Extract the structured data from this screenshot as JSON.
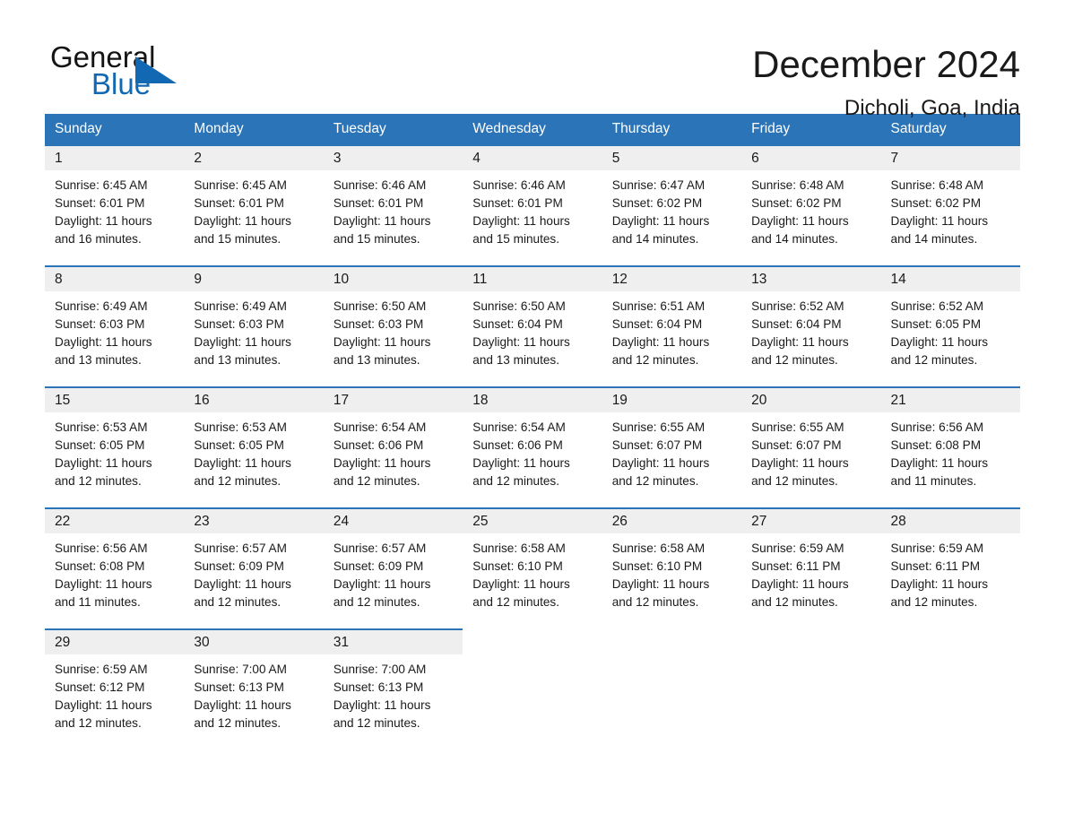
{
  "brand": {
    "name_part1": "General",
    "name_part2": "Blue",
    "triangle_icon": "brand-triangle-icon",
    "accent_color": "#1268b3"
  },
  "header": {
    "month_title": "December 2024",
    "location": "Dicholi, Goa, India"
  },
  "theme": {
    "header_blue": "#2b74b8",
    "row_border_blue": "#2b74b8",
    "daynum_band_gray": "#efefef",
    "text_color": "#1a1a1a"
  },
  "weekday_headers": [
    "Sunday",
    "Monday",
    "Tuesday",
    "Wednesday",
    "Thursday",
    "Friday",
    "Saturday"
  ],
  "weeks": [
    [
      {
        "day": "1",
        "sunrise": "Sunrise: 6:45 AM",
        "sunset": "Sunset: 6:01 PM",
        "daylight": "Daylight: 11 hours and 16 minutes."
      },
      {
        "day": "2",
        "sunrise": "Sunrise: 6:45 AM",
        "sunset": "Sunset: 6:01 PM",
        "daylight": "Daylight: 11 hours and 15 minutes."
      },
      {
        "day": "3",
        "sunrise": "Sunrise: 6:46 AM",
        "sunset": "Sunset: 6:01 PM",
        "daylight": "Daylight: 11 hours and 15 minutes."
      },
      {
        "day": "4",
        "sunrise": "Sunrise: 6:46 AM",
        "sunset": "Sunset: 6:01 PM",
        "daylight": "Daylight: 11 hours and 15 minutes."
      },
      {
        "day": "5",
        "sunrise": "Sunrise: 6:47 AM",
        "sunset": "Sunset: 6:02 PM",
        "daylight": "Daylight: 11 hours and 14 minutes."
      },
      {
        "day": "6",
        "sunrise": "Sunrise: 6:48 AM",
        "sunset": "Sunset: 6:02 PM",
        "daylight": "Daylight: 11 hours and 14 minutes."
      },
      {
        "day": "7",
        "sunrise": "Sunrise: 6:48 AM",
        "sunset": "Sunset: 6:02 PM",
        "daylight": "Daylight: 11 hours and 14 minutes."
      }
    ],
    [
      {
        "day": "8",
        "sunrise": "Sunrise: 6:49 AM",
        "sunset": "Sunset: 6:03 PM",
        "daylight": "Daylight: 11 hours and 13 minutes."
      },
      {
        "day": "9",
        "sunrise": "Sunrise: 6:49 AM",
        "sunset": "Sunset: 6:03 PM",
        "daylight": "Daylight: 11 hours and 13 minutes."
      },
      {
        "day": "10",
        "sunrise": "Sunrise: 6:50 AM",
        "sunset": "Sunset: 6:03 PM",
        "daylight": "Daylight: 11 hours and 13 minutes."
      },
      {
        "day": "11",
        "sunrise": "Sunrise: 6:50 AM",
        "sunset": "Sunset: 6:04 PM",
        "daylight": "Daylight: 11 hours and 13 minutes."
      },
      {
        "day": "12",
        "sunrise": "Sunrise: 6:51 AM",
        "sunset": "Sunset: 6:04 PM",
        "daylight": "Daylight: 11 hours and 12 minutes."
      },
      {
        "day": "13",
        "sunrise": "Sunrise: 6:52 AM",
        "sunset": "Sunset: 6:04 PM",
        "daylight": "Daylight: 11 hours and 12 minutes."
      },
      {
        "day": "14",
        "sunrise": "Sunrise: 6:52 AM",
        "sunset": "Sunset: 6:05 PM",
        "daylight": "Daylight: 11 hours and 12 minutes."
      }
    ],
    [
      {
        "day": "15",
        "sunrise": "Sunrise: 6:53 AM",
        "sunset": "Sunset: 6:05 PM",
        "daylight": "Daylight: 11 hours and 12 minutes."
      },
      {
        "day": "16",
        "sunrise": "Sunrise: 6:53 AM",
        "sunset": "Sunset: 6:05 PM",
        "daylight": "Daylight: 11 hours and 12 minutes."
      },
      {
        "day": "17",
        "sunrise": "Sunrise: 6:54 AM",
        "sunset": "Sunset: 6:06 PM",
        "daylight": "Daylight: 11 hours and 12 minutes."
      },
      {
        "day": "18",
        "sunrise": "Sunrise: 6:54 AM",
        "sunset": "Sunset: 6:06 PM",
        "daylight": "Daylight: 11 hours and 12 minutes."
      },
      {
        "day": "19",
        "sunrise": "Sunrise: 6:55 AM",
        "sunset": "Sunset: 6:07 PM",
        "daylight": "Daylight: 11 hours and 12 minutes."
      },
      {
        "day": "20",
        "sunrise": "Sunrise: 6:55 AM",
        "sunset": "Sunset: 6:07 PM",
        "daylight": "Daylight: 11 hours and 12 minutes."
      },
      {
        "day": "21",
        "sunrise": "Sunrise: 6:56 AM",
        "sunset": "Sunset: 6:08 PM",
        "daylight": "Daylight: 11 hours and 11 minutes."
      }
    ],
    [
      {
        "day": "22",
        "sunrise": "Sunrise: 6:56 AM",
        "sunset": "Sunset: 6:08 PM",
        "daylight": "Daylight: 11 hours and 11 minutes."
      },
      {
        "day": "23",
        "sunrise": "Sunrise: 6:57 AM",
        "sunset": "Sunset: 6:09 PM",
        "daylight": "Daylight: 11 hours and 12 minutes."
      },
      {
        "day": "24",
        "sunrise": "Sunrise: 6:57 AM",
        "sunset": "Sunset: 6:09 PM",
        "daylight": "Daylight: 11 hours and 12 minutes."
      },
      {
        "day": "25",
        "sunrise": "Sunrise: 6:58 AM",
        "sunset": "Sunset: 6:10 PM",
        "daylight": "Daylight: 11 hours and 12 minutes."
      },
      {
        "day": "26",
        "sunrise": "Sunrise: 6:58 AM",
        "sunset": "Sunset: 6:10 PM",
        "daylight": "Daylight: 11 hours and 12 minutes."
      },
      {
        "day": "27",
        "sunrise": "Sunrise: 6:59 AM",
        "sunset": "Sunset: 6:11 PM",
        "daylight": "Daylight: 11 hours and 12 minutes."
      },
      {
        "day": "28",
        "sunrise": "Sunrise: 6:59 AM",
        "sunset": "Sunset: 6:11 PM",
        "daylight": "Daylight: 11 hours and 12 minutes."
      }
    ],
    [
      {
        "day": "29",
        "sunrise": "Sunrise: 6:59 AM",
        "sunset": "Sunset: 6:12 PM",
        "daylight": "Daylight: 11 hours and 12 minutes."
      },
      {
        "day": "30",
        "sunrise": "Sunrise: 7:00 AM",
        "sunset": "Sunset: 6:13 PM",
        "daylight": "Daylight: 11 hours and 12 minutes."
      },
      {
        "day": "31",
        "sunrise": "Sunrise: 7:00 AM",
        "sunset": "Sunset: 6:13 PM",
        "daylight": "Daylight: 11 hours and 12 minutes."
      },
      null,
      null,
      null,
      null
    ]
  ]
}
